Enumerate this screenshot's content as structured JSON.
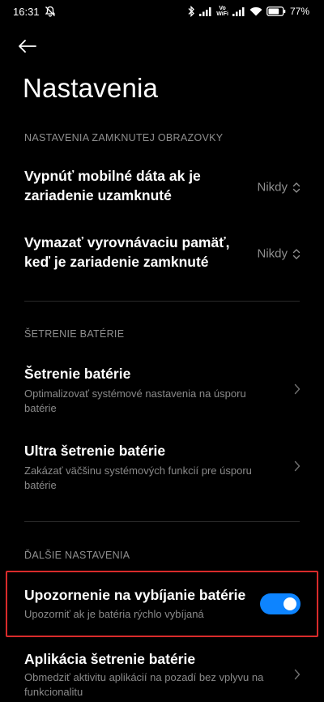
{
  "status_bar": {
    "time": "16:31",
    "volte_top": "Vo",
    "volte_bottom": "WiFi",
    "battery_percent": "77",
    "battery_level": 0.77
  },
  "header": {
    "title": "Nastavenia"
  },
  "sections": [
    {
      "header": "NASTAVENIA ZAMKNUTEJ OBRAZOVKY",
      "items": [
        {
          "title": "Vypnúť mobilné dáta ak je zariadenie uzamknuté",
          "value": "Nikdy"
        },
        {
          "title": "Vymazať vyrovnávaciu pamäť, keď je zariadenie zamknuté",
          "value": "Nikdy"
        }
      ]
    },
    {
      "header": "ŠETRENIE BATÉRIE",
      "items": [
        {
          "title": "Šetrenie batérie",
          "subtitle": "Optimalizovať systémové nastavenia na úsporu batérie"
        },
        {
          "title": "Ultra šetrenie batérie",
          "subtitle": "Zakázať väčšinu systémových funkcií pre úsporu batérie"
        }
      ]
    },
    {
      "header": "ĎALŠIE NASTAVENIA",
      "items": [
        {
          "title": "Upozornenie na vybíjanie batérie",
          "subtitle": "Upozorniť ak je batéria rýchlo vybíjaná",
          "toggle_on": true
        },
        {
          "title": "Aplikácia šetrenie batérie",
          "subtitle": "Obmedziť aktivitu aplikácií na pozadí bez vplyvu na funkcionalitu"
        }
      ]
    }
  ],
  "colors": {
    "background": "#000000",
    "accent": "#0d84ff",
    "highlight": "#d92b2b",
    "secondary_text": "#8a8a8a"
  }
}
